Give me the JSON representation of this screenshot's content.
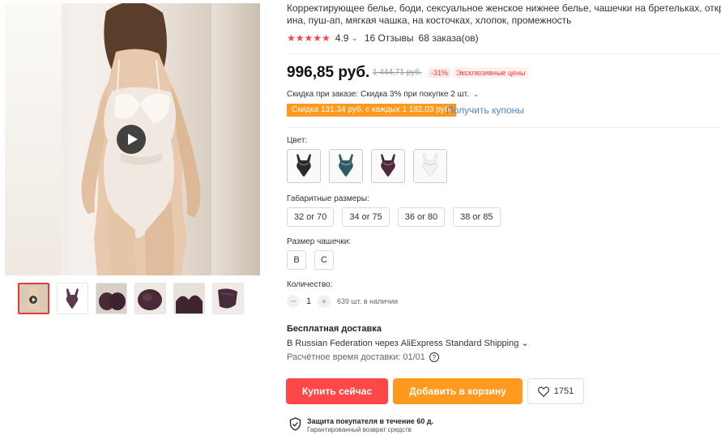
{
  "product": {
    "title_line1": "Корректирующее белье, боди, сексуальное женское нижнее белье, чашечки на бретельках, открытая сп",
    "title_line2": "ина, пуш-ап, мягкая чашка, на косточках, хлопок, промежность",
    "rating": "4.9",
    "rating_chevron": "⌄",
    "reviews": "16 Отзывы",
    "orders": "68 заказа(ов)"
  },
  "price": {
    "current": "996,85 руб.",
    "old": "1 444,71 руб.",
    "discount": "-31%",
    "exclusive": "Эксклюзивные цены"
  },
  "promo": {
    "order_discount": "Скидка при заказе: Скидка 3% при покупке 2 шт.",
    "coupon_badge": "Скидка 131,34 руб. с каждых 1 182,03 руб.",
    "coupon_link": "Получить купоны"
  },
  "options": {
    "color_label": "Цвет:",
    "colors": [
      "black-lace",
      "teal-lace",
      "plum-lace",
      "white-lace"
    ],
    "size_label": "Габаритные размеры:",
    "sizes": [
      "32 or 70",
      "34 or 75",
      "36 or 80",
      "38 or 85"
    ],
    "cup_label": "Размер чашечки:",
    "cups": [
      "B",
      "C"
    ]
  },
  "quantity": {
    "label": "Количество:",
    "minus": "−",
    "value": "1",
    "plus": "+",
    "stock": "639 шт. в наличии"
  },
  "shipping": {
    "title": "Бесплатная доставка",
    "line": "В Russian Federation через AliExpress Standard Shipping ⌄",
    "time": "Расчётное время доставки: 01/01",
    "help_icon": "?"
  },
  "actions": {
    "buy": "Купить сейчас",
    "cart": "Добавить в корзину",
    "wish_count": "1751"
  },
  "protection": {
    "title": "Защита покупателя в течение 60 д.",
    "subtitle": "Гарантированный возврат средств"
  },
  "colors": {
    "accent_red": "#ff4747",
    "accent_orange": "#ff9a1e",
    "link_blue": "#4e84d8"
  }
}
